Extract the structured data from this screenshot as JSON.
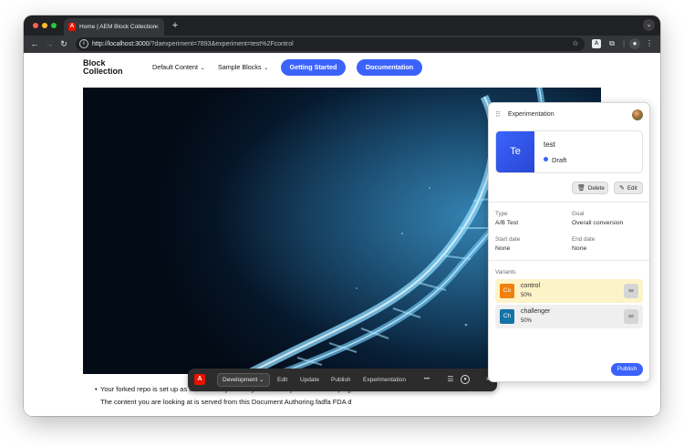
{
  "browser": {
    "tab_title": "Home | AEM Block Collection",
    "tab_favicon_letter": "A",
    "new_tab_symbol": "+",
    "tab_close_symbol": "×",
    "url_host": "http://localhost:3000",
    "url_path": "/?daexperiment=7893&experiment=test%2Fcontrol",
    "extension_letter": "A"
  },
  "site": {
    "brand": "Block Collection",
    "nav": [
      {
        "label": "Default Content"
      },
      {
        "label": "Sample Blocks"
      }
    ],
    "buttons": {
      "getting_started": "Getting Started",
      "documentation": "Documentation"
    },
    "bullet": "•",
    "content": {
      "line1": "Your forked repo is set up as an AEM Project and you are ready to start developing.",
      "line2": "The content you are looking at is served from this Document Authoring.fadfa FDA d"
    }
  },
  "sidekick": {
    "logo_letter": "A",
    "environment": "Development",
    "actions": [
      "Edit",
      "Update",
      "Publish",
      "Experimentation"
    ],
    "more_symbol": "•••",
    "menu_symbol": "☰",
    "close_symbol": "×"
  },
  "experimentation": {
    "title": "Experimentation",
    "experiment": {
      "thumb": "Te",
      "name": "test",
      "status": "Draft"
    },
    "delete_label": "Delete",
    "edit_label": "Edit",
    "type_label": "Type",
    "type_value": "A/B Test",
    "goal_label": "Goal",
    "goal_value": "Overall conversion",
    "start_label": "Start date",
    "start_value": "None",
    "end_label": "End date",
    "end_value": "None",
    "variants_label": "Variants",
    "variants": [
      {
        "thumb": "Co",
        "name": "control",
        "split": "50%",
        "color": "#f0810f",
        "bg": "#fdf3c8"
      },
      {
        "thumb": "Ch",
        "name": "challenger",
        "split": "50%",
        "color": "#1473a8",
        "bg": "#efefef"
      }
    ],
    "publish_label": "Publish"
  },
  "colors": {
    "accent": "#3b63fb",
    "adobe_red": "#eb1000"
  }
}
